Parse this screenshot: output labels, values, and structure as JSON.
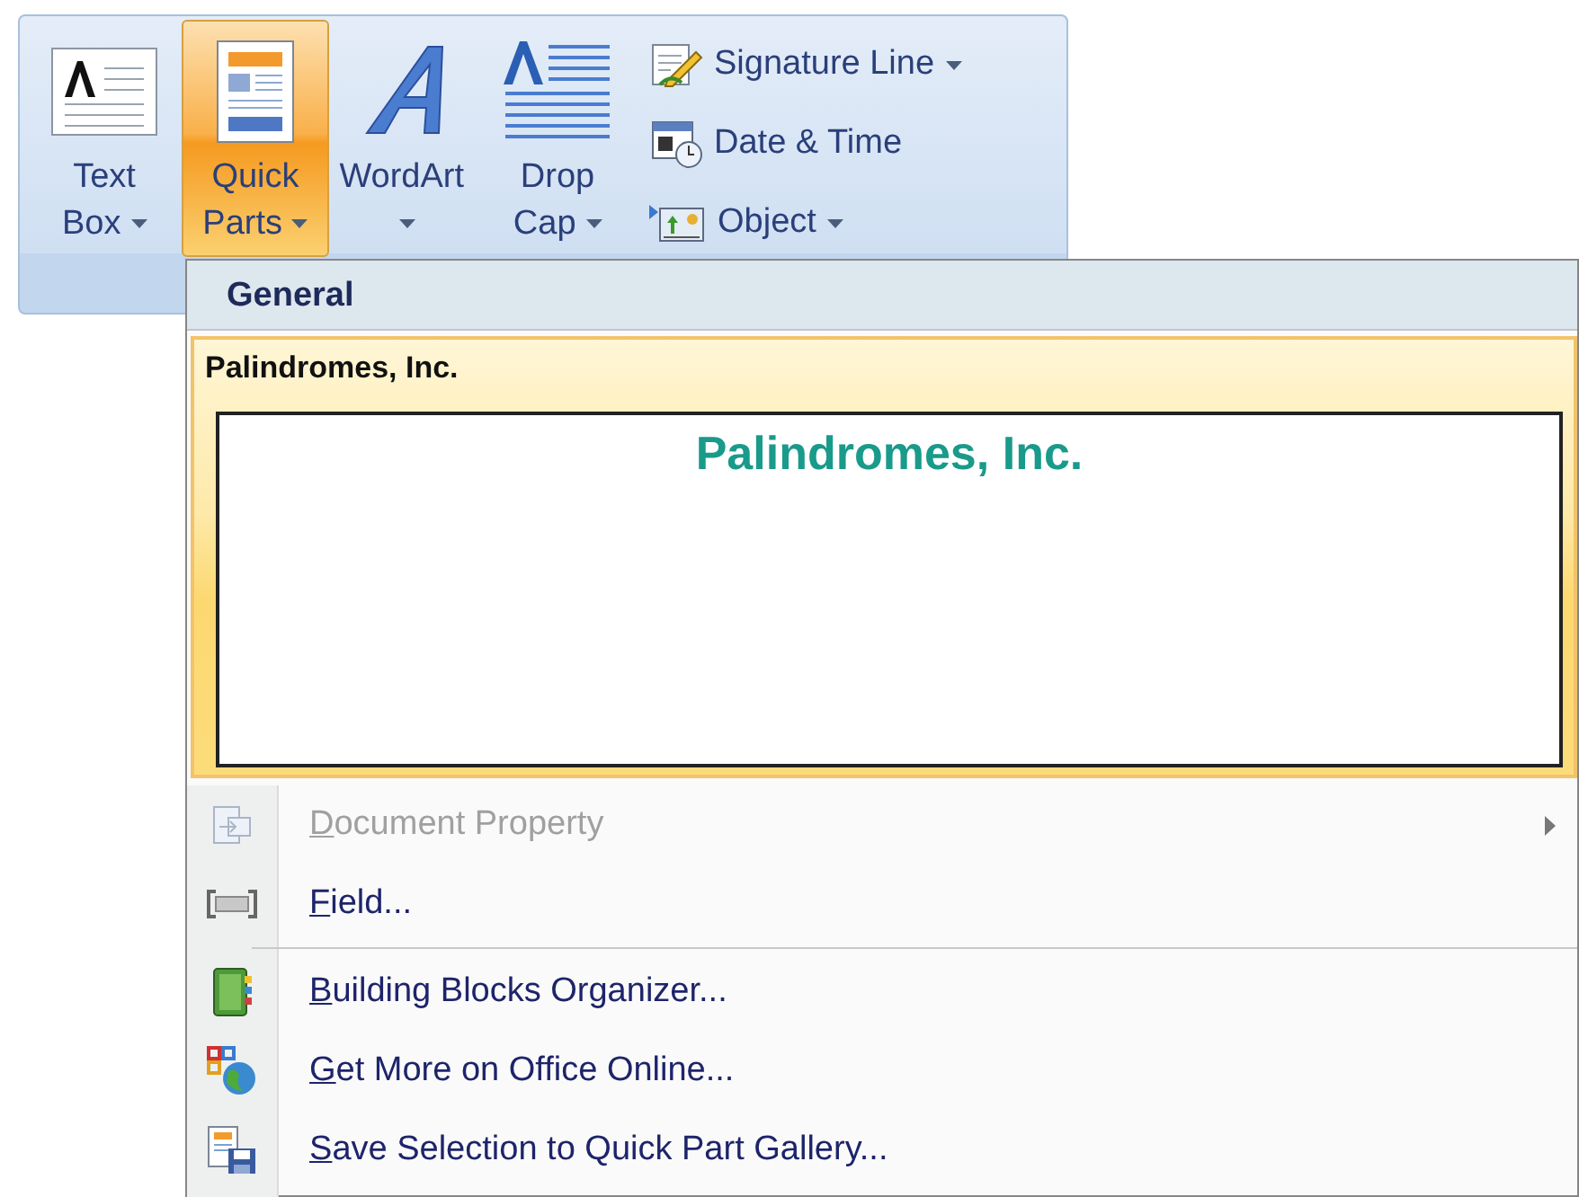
{
  "ribbon": {
    "large_buttons": [
      {
        "label": "Text Box",
        "dropdown": true,
        "selected": false
      },
      {
        "label": "Quick Parts",
        "dropdown": true,
        "selected": true
      },
      {
        "label": "WordArt",
        "dropdown": true,
        "selected": false
      },
      {
        "label": "Drop Cap",
        "dropdown": true,
        "selected": false
      }
    ],
    "small_buttons": [
      {
        "label": "Signature Line",
        "dropdown": true
      },
      {
        "label": "Date & Time",
        "dropdown": false
      },
      {
        "label": "Object",
        "dropdown": true
      }
    ]
  },
  "menu": {
    "header": "General",
    "gallery_item": {
      "title": "Palindromes, Inc.",
      "preview_text": "Palindromes, Inc.",
      "selected": true
    },
    "items": [
      {
        "kind": "command",
        "label": "Document Property",
        "disabled": true,
        "submenu": true
      },
      {
        "kind": "command",
        "label": "Field...",
        "disabled": false,
        "submenu": false
      },
      {
        "kind": "separator"
      },
      {
        "kind": "command",
        "label": "Building Blocks Organizer...",
        "disabled": false,
        "submenu": false
      },
      {
        "kind": "command",
        "label": "Get More on Office Online...",
        "disabled": false,
        "submenu": false
      },
      {
        "kind": "command",
        "label": "Save Selection to Quick Part Gallery...",
        "disabled": false,
        "submenu": false
      }
    ]
  }
}
